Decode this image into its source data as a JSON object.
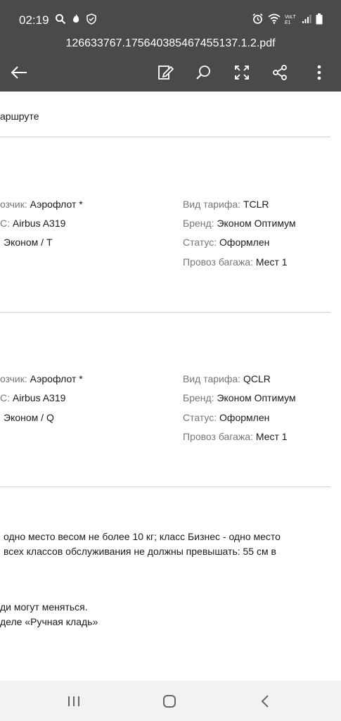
{
  "status_bar": {
    "time": "02:19",
    "network_label": "VoLTE1"
  },
  "header": {
    "file_name": "126633767.175640385467455137.1.2.pdf"
  },
  "toolbar": {
    "icons": [
      "back-arrow-icon",
      "edit-pen-icon",
      "search-icon",
      "fullscreen-icon",
      "share-icon",
      "more-vert-icon"
    ]
  },
  "document": {
    "top_fragment": "аршруте",
    "segments": [
      {
        "carrier_label": "озчик:",
        "carrier_value": "Аэрофлот *",
        "aircraft_label": "С:",
        "aircraft_value": "Airbus A319",
        "class_value": "Эконом / T",
        "fare_label": "Вид тарифа:",
        "fare_value": "TCLR",
        "brand_label": "Бренд:",
        "brand_value": "Эконом Оптимум",
        "status_label": "Статус:",
        "status_value": "Оформлен",
        "baggage_label": "Провоз багажа:",
        "baggage_value": "Мест 1"
      },
      {
        "carrier_label": "озчик:",
        "carrier_value": "Аэрофлот *",
        "aircraft_label": "С:",
        "aircraft_value": "Airbus A319",
        "class_value": "Эконом / Q",
        "fare_label": "Вид тарифа:",
        "fare_value": "QCLR",
        "brand_label": "Бренд:",
        "brand_value": "Эконом Оптимум",
        "status_label": "Статус:",
        "status_value": "Оформлен",
        "baggage_label": "Провоз багажа:",
        "baggage_value": "Мест 1"
      }
    ],
    "baggage_text_line1": "одно место весом не более 10 кг; класс Бизнес - одно место",
    "baggage_text_line2": "всех классов обслуживания не должны превышать: 55 см в",
    "note_line1": "ди могут меняться.",
    "note_line2": "деле «Ручная кладь»"
  },
  "navbar": {
    "icons": [
      "recent-apps-icon",
      "home-icon",
      "back-icon"
    ]
  }
}
